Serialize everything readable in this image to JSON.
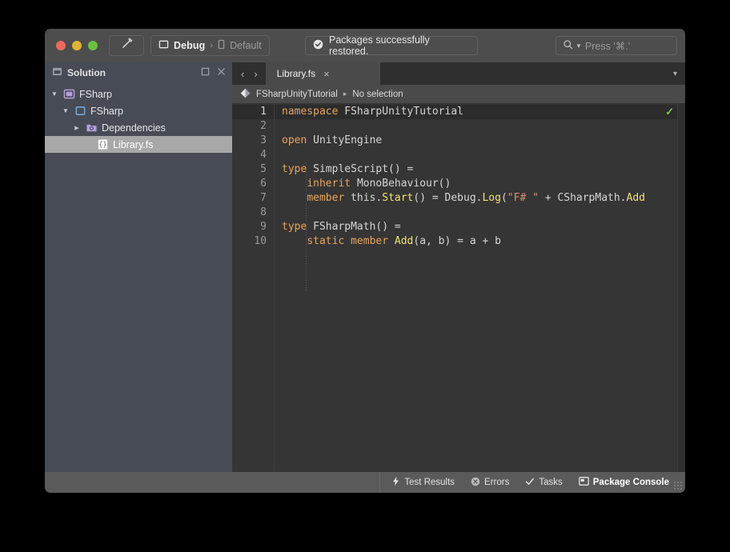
{
  "window": {
    "traffic_lights": [
      {
        "name": "close",
        "color": "#eb6a5d"
      },
      {
        "name": "minimize",
        "color": "#e0b237"
      },
      {
        "name": "zoom",
        "color": "#6bbf42"
      }
    ]
  },
  "toolbar": {
    "run_icon": "build-hammer-icon",
    "configuration": "Debug",
    "separator": "›",
    "runtime": "Default",
    "status_message": "Packages successfully restored.",
    "status_icon": "check-circle-icon",
    "search_placeholder": "Press '⌘.'",
    "search_icon": "search-icon",
    "search_value": ""
  },
  "sidebar": {
    "title": "Solution",
    "title_icon": "solution-pad-icon",
    "pin_icon": "pin-icon",
    "close_icon": "close-icon",
    "tree": [
      {
        "label": "FSharp",
        "icon": "solution-icon",
        "depth": 0,
        "twisty": "▼",
        "selected": false
      },
      {
        "label": "FSharp",
        "icon": "project-icon",
        "depth": 1,
        "twisty": "▼",
        "selected": false
      },
      {
        "label": "Dependencies",
        "icon": "dependencies-icon",
        "depth": 2,
        "twisty": "▶",
        "selected": false
      },
      {
        "label": "Library.fs",
        "icon": "fsharp-file-icon",
        "depth": 3,
        "twisty": "",
        "selected": true
      }
    ]
  },
  "editor": {
    "nav_back": "‹",
    "nav_forward": "›",
    "tab_label": "Library.fs",
    "tab_close": "×",
    "tab_menu": "▾",
    "breadcrumb_icon": "fsharp-logo-icon",
    "breadcrumb_scope": "FSharpUnityTutorial",
    "breadcrumb_arrow": "▸",
    "breadcrumb_selection": "No selection",
    "status_check": "✓",
    "line_numbers": [
      1,
      2,
      3,
      4,
      5,
      6,
      7,
      8,
      9,
      10
    ],
    "active_line": 1,
    "lines": [
      [
        {
          "t": "namespace ",
          "c": "k"
        },
        {
          "t": "FSharpUnityTutorial",
          "c": ""
        }
      ],
      [],
      [
        {
          "t": "open ",
          "c": "k"
        },
        {
          "t": "UnityEngine",
          "c": ""
        }
      ],
      [],
      [
        {
          "t": "type ",
          "c": "k"
        },
        {
          "t": "SimpleScript() =",
          "c": ""
        }
      ],
      [
        {
          "t": "    ",
          "c": ""
        },
        {
          "t": "inherit ",
          "c": "k"
        },
        {
          "t": "MonoBehaviour()",
          "c": ""
        }
      ],
      [
        {
          "t": "    ",
          "c": ""
        },
        {
          "t": "member ",
          "c": "k"
        },
        {
          "t": "this.",
          "c": ""
        },
        {
          "t": "Start",
          "c": "m"
        },
        {
          "t": "() = Debug.",
          "c": ""
        },
        {
          "t": "Log",
          "c": "m"
        },
        {
          "t": "(",
          "c": ""
        },
        {
          "t": "\"F# \"",
          "c": "s"
        },
        {
          "t": " + CSharpMath.",
          "c": ""
        },
        {
          "t": "Add",
          "c": "m"
        }
      ],
      [],
      [
        {
          "t": "type ",
          "c": "k"
        },
        {
          "t": "FSharpMath() =",
          "c": ""
        }
      ],
      [
        {
          "t": "    ",
          "c": ""
        },
        {
          "t": "static member ",
          "c": "k"
        },
        {
          "t": "Add",
          "c": "m"
        },
        {
          "t": "(a, b) = a + b",
          "c": ""
        }
      ]
    ]
  },
  "statusbar": {
    "pads": [
      {
        "label": "Test Results",
        "icon": "lightning-icon",
        "active": false
      },
      {
        "label": "Errors",
        "icon": "error-circle-icon",
        "active": false
      },
      {
        "label": "Tasks",
        "icon": "checkmark-icon",
        "active": false
      },
      {
        "label": "Package Console",
        "icon": "console-icon",
        "active": true
      }
    ]
  },
  "colors": {
    "keyword": "#e8a35c",
    "method": "#f1e27a",
    "string": "#e08b78",
    "success": "#84c14c"
  }
}
